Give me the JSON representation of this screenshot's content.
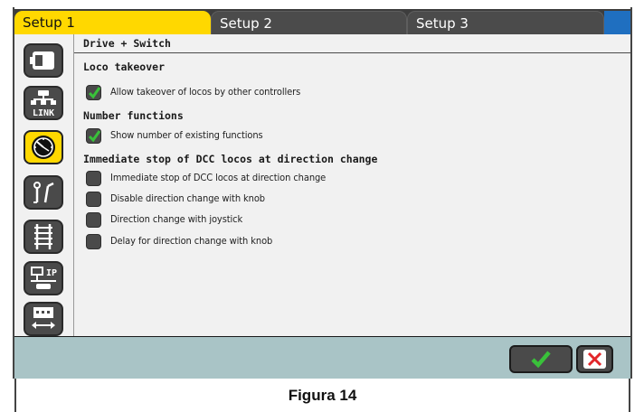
{
  "tabs": [
    {
      "label": "Setup 1",
      "active": true
    },
    {
      "label": "Setup 2",
      "active": false
    },
    {
      "label": "Setup 3",
      "active": false
    }
  ],
  "sidebar": {
    "items": [
      {
        "icon": "loco-icon",
        "active": false
      },
      {
        "icon": "link-network-icon",
        "label": "LINK",
        "active": false
      },
      {
        "icon": "clock-gauge-icon",
        "active": true
      },
      {
        "icon": "turnout-signal-icon",
        "active": false
      },
      {
        "icon": "track-icon",
        "active": false
      },
      {
        "icon": "ip-network-icon",
        "label": "IP",
        "active": false
      },
      {
        "icon": "keyboard-transfer-icon",
        "active": false
      }
    ]
  },
  "content": {
    "header": "Drive + Switch",
    "sections": [
      {
        "title": "Loco takeover",
        "options": [
          {
            "label": "Allow takeover of locos by other controllers",
            "checked": true
          }
        ]
      },
      {
        "title": "Number functions",
        "options": [
          {
            "label": "Show number of existing functions",
            "checked": true
          }
        ]
      },
      {
        "title": "Immediate stop of DCC locos at direction change",
        "options": [
          {
            "label": "Immediate stop of DCC locos at direction change",
            "checked": false
          },
          {
            "label": "Disable direction change with knob",
            "checked": false
          },
          {
            "label": "Direction change with joystick",
            "checked": false
          },
          {
            "label": "Delay for direction change with knob",
            "checked": false
          }
        ]
      }
    ]
  },
  "footer": {
    "confirm_icon": "checkmark-icon",
    "cancel_icon": "close-x-icon"
  },
  "caption": "Figura 14",
  "colors": {
    "active_tab": "#ffd800",
    "check_green": "#39c13a",
    "cancel_red": "#e2262a",
    "footer_bg": "#a9c4c6"
  }
}
